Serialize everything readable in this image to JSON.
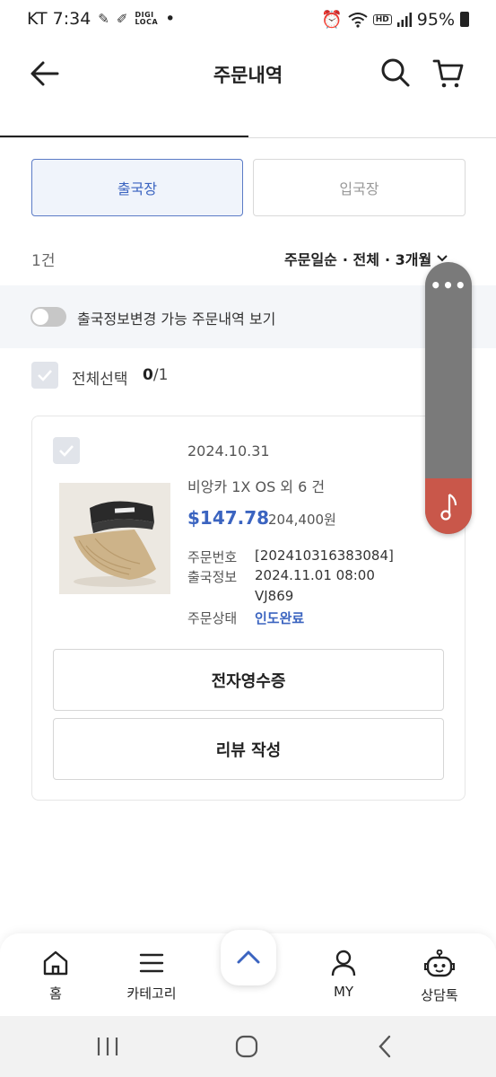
{
  "status_bar": {
    "carrier_time": "KT 7:34",
    "app_label_top": "DIGI",
    "app_label_bottom": "LOCA",
    "dot": "•",
    "hd": "HD",
    "battery": "95%"
  },
  "header": {
    "title": "주문내역",
    "back_icon": "arrow-left-icon",
    "search_icon": "search-icon",
    "cart_icon": "cart-icon"
  },
  "segment": {
    "departure": "출국장",
    "arrival": "입국장"
  },
  "list_meta": {
    "count": "1건",
    "sort": "주문일순",
    "filter_all": "· 전체",
    "filter_period": "· 3개월"
  },
  "toggle_band": {
    "label": "출국정보변경 가능 주문내역 보기",
    "enabled": false
  },
  "select_all": {
    "label": "전체선택",
    "selected": "0",
    "total": "/1"
  },
  "order": {
    "date": "2024.10.31",
    "product": "비앙카 1X OS 외 6 건",
    "price_usd": "$147.78",
    "price_krw": "204,400원",
    "info": [
      {
        "label": "주문번호",
        "value": "[202410316383084]"
      },
      {
        "label": "출국정보",
        "value": "2024.11.01 08:00"
      },
      {
        "label": "",
        "value": "VJ869"
      },
      {
        "label": "주문상태",
        "value": "인도완료"
      }
    ],
    "receipt_button": "전자영수증",
    "review_button": "리뷰 작성"
  },
  "bottom_nav": {
    "items": [
      {
        "label": "홈",
        "icon": "home-icon"
      },
      {
        "label": "카테고리",
        "icon": "menu-icon"
      },
      {
        "label": "MY",
        "icon": "person-icon"
      },
      {
        "label": "상담톡",
        "icon": "chatbot-icon"
      }
    ],
    "top_button_icon": "chevron-up-icon"
  },
  "colors": {
    "accent": "#3b64c0",
    "widget_gray": "#7a7a7a",
    "widget_red": "#c9574a"
  }
}
